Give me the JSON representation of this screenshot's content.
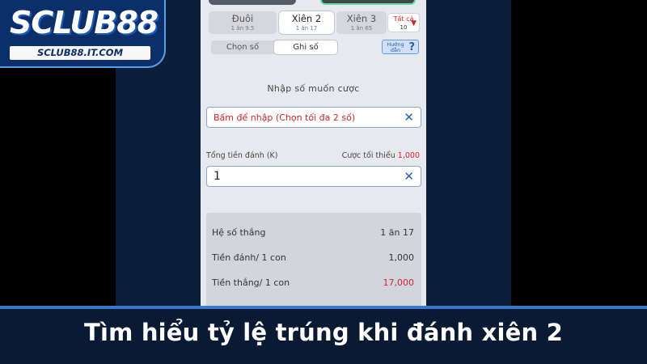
{
  "brand": {
    "logo_text": "SCLUB88",
    "logo_url_text": "SCLUB88.IT.COM"
  },
  "bet_tabs": [
    {
      "label": "Đuôi",
      "odds": "1 ăn 9.5"
    },
    {
      "label": "Xiên 2",
      "odds": "1 ăn 17"
    },
    {
      "label": "Xiên 3",
      "odds": "1 ăn 65"
    }
  ],
  "filter": {
    "label": "Tất cả",
    "count": "10"
  },
  "mode": {
    "left": "Chọn số",
    "right": "Ghi số"
  },
  "help": {
    "label": "Hướng dẫn"
  },
  "form": {
    "section_title": "Nhập số muốn cược",
    "number_placeholder": "Bấm để nhập (Chọn tối đa 2 số)",
    "total_label": "Tổng tiền đánh (K)",
    "min_label": "Cược tối thiểu",
    "min_value": "1,000",
    "amount_value": "1"
  },
  "summary": [
    {
      "key": "Hệ số thắng",
      "value": "1 ăn 17"
    },
    {
      "key": "Tiền đánh/ 1 con",
      "value": "1,000"
    },
    {
      "key": "Tiền thắng/ 1 con",
      "value": "17,000"
    }
  ],
  "caption": "Tìm hiểu tỷ lệ trúng khi đánh xiên 2",
  "colors": {
    "accent_red": "#d0252a",
    "accent_blue": "#2a63b5",
    "caption_bg": "#0b1a33"
  }
}
